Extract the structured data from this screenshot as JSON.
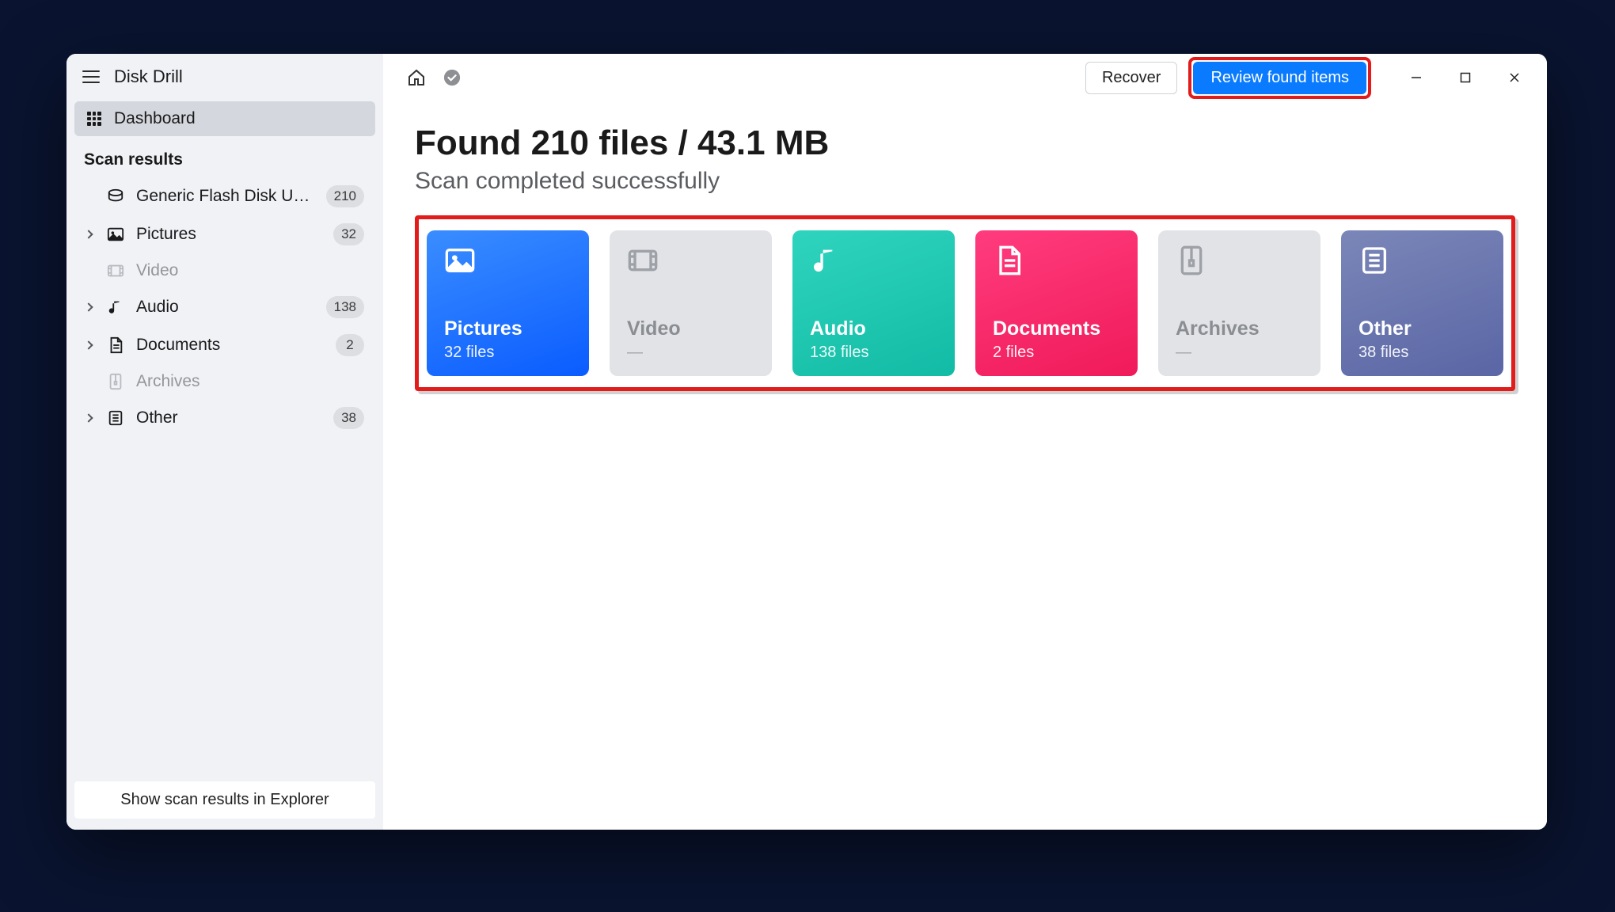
{
  "app_title": "Disk Drill",
  "sidebar": {
    "dashboard_label": "Dashboard",
    "section_label": "Scan results",
    "items": [
      {
        "label": "Generic Flash Disk USB...",
        "count": "210",
        "expandable": false,
        "muted": false,
        "icon": "drive"
      },
      {
        "label": "Pictures",
        "count": "32",
        "expandable": true,
        "muted": false,
        "icon": "pictures"
      },
      {
        "label": "Video",
        "count": "",
        "expandable": false,
        "muted": true,
        "icon": "video"
      },
      {
        "label": "Audio",
        "count": "138",
        "expandable": true,
        "muted": false,
        "icon": "audio"
      },
      {
        "label": "Documents",
        "count": "2",
        "expandable": true,
        "muted": false,
        "icon": "documents"
      },
      {
        "label": "Archives",
        "count": "",
        "expandable": false,
        "muted": true,
        "icon": "archives"
      },
      {
        "label": "Other",
        "count": "38",
        "expandable": true,
        "muted": false,
        "icon": "other"
      }
    ],
    "footer_button": "Show scan results in Explorer"
  },
  "titlebar": {
    "recover_label": "Recover",
    "review_label": "Review found items"
  },
  "heading": {
    "title": "Found 210 files / 43.1 MB",
    "subtitle": "Scan completed successfully"
  },
  "cards": [
    {
      "title": "Pictures",
      "sub": "32 files",
      "variant": "pictures",
      "icon": "pictures"
    },
    {
      "title": "Video",
      "sub": "—",
      "variant": "muted",
      "icon": "video"
    },
    {
      "title": "Audio",
      "sub": "138 files",
      "variant": "audio",
      "icon": "audio"
    },
    {
      "title": "Documents",
      "sub": "2 files",
      "variant": "docs",
      "icon": "documents"
    },
    {
      "title": "Archives",
      "sub": "—",
      "variant": "muted",
      "icon": "archives"
    },
    {
      "title": "Other",
      "sub": "38 files",
      "variant": "other",
      "icon": "other"
    }
  ]
}
